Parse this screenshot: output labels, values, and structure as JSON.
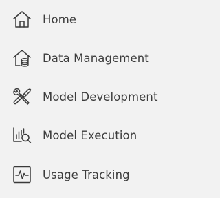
{
  "nav": {
    "items": [
      {
        "label": "Home",
        "icon": "home-icon"
      },
      {
        "label": "Data Management",
        "icon": "data-management-icon"
      },
      {
        "label": "Model Development",
        "icon": "tools-icon"
      },
      {
        "label": "Model Execution",
        "icon": "chart-search-icon"
      },
      {
        "label": "Usage Tracking",
        "icon": "pulse-monitor-icon"
      }
    ]
  },
  "colors": {
    "background": "#f2f2f2",
    "text": "#3c3c3c",
    "icon": "#3a3a3a"
  }
}
